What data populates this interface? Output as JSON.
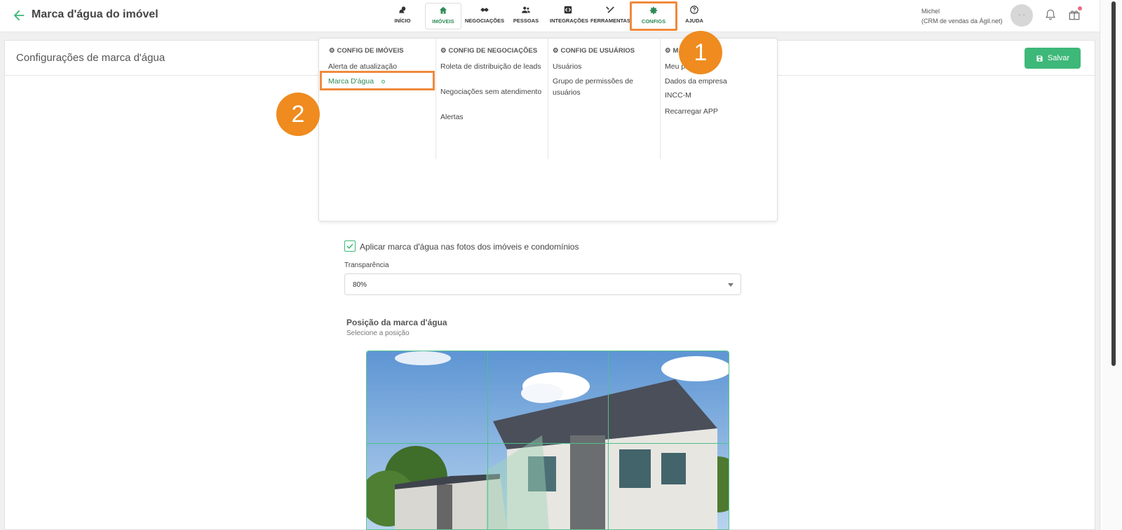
{
  "header": {
    "title": "Marca d'água do imóvel",
    "nav": [
      {
        "label": "INÍCIO",
        "icon": "squirrel-icon"
      },
      {
        "label": "IMÓVEIS",
        "icon": "home-icon"
      },
      {
        "label": "NEGOCIAÇÕES",
        "icon": "handshake-icon"
      },
      {
        "label": "PESSOAS",
        "icon": "people-icon"
      },
      {
        "label": "INTEGRAÇÕES",
        "icon": "code-icon"
      },
      {
        "label": "FERRAMENTAS",
        "icon": "tools-icon"
      },
      {
        "label": "CONFIGS",
        "icon": "gear-icon"
      },
      {
        "label": "AJUDA",
        "icon": "help-icon"
      }
    ],
    "user_name": "Michel",
    "user_org": "(CRM de vendas da Ágil.net)",
    "avatar_text": "- -"
  },
  "menu": {
    "columns": [
      {
        "title": "CONFIG DE IMÓVEIS",
        "items": [
          "Alerta de atualização",
          "Marca D'água"
        ]
      },
      {
        "title": "CONFIG DE NEGOCIAÇÕES",
        "items": [
          "Roleta de distribuição de leads",
          "Negociações sem atendimento",
          "Alertas"
        ]
      },
      {
        "title": "CONFIG DE USUÁRIOS",
        "items": [
          "Usuários",
          "Grupo de permissões de usuários"
        ]
      },
      {
        "title": "MA",
        "items": [
          "Meu p",
          "Dados da empresa",
          "INCC-M",
          "Recarregar APP"
        ]
      }
    ]
  },
  "card": {
    "title": "Configurações de marca d'água",
    "save_label": "Salvar"
  },
  "form": {
    "checkbox_label": "Aplicar marca d'água nas fotos dos imóveis e condomínios",
    "checkbox_checked": true,
    "transparency_label": "Transparência",
    "transparency_value": "80%",
    "position_title": "Posição da marca d'água",
    "position_subtitle": "Selecione a posição"
  },
  "annotations": {
    "step1": "1",
    "step2": "2"
  },
  "colors": {
    "accent": "#3db878",
    "highlight": "#f08a3c",
    "badge": "#ef8b1f"
  }
}
